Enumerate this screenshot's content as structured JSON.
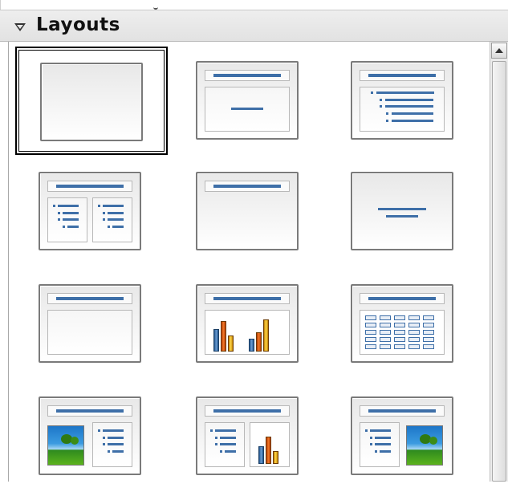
{
  "panel": {
    "title": "Layouts",
    "collapse_icon": "triangle-down-icon"
  },
  "layouts": [
    {
      "id": "blank-slide",
      "icon": "layout-blank-icon"
    },
    {
      "id": "title-slide",
      "icon": "layout-title-subtitle-icon"
    },
    {
      "id": "title-content",
      "icon": "layout-title-content-icon"
    },
    {
      "id": "title-2-content",
      "icon": "layout-title-2-content-icon"
    },
    {
      "id": "title-only",
      "icon": "layout-title-only-icon"
    },
    {
      "id": "centered-text",
      "icon": "layout-centered-text-icon"
    },
    {
      "id": "title-2-content-text",
      "icon": "layout-title-text-icon"
    },
    {
      "id": "title-chart",
      "icon": "layout-title-chart-icon"
    },
    {
      "id": "title-table",
      "icon": "layout-title-table-icon"
    },
    {
      "id": "title-picture-text",
      "icon": "layout-title-picture-text-icon"
    },
    {
      "id": "title-text-chart",
      "icon": "layout-title-text-chart-icon"
    },
    {
      "id": "title-text-picture",
      "icon": "layout-title-text-picture-icon"
    }
  ],
  "selected_index": 0,
  "colors": {
    "accent": "#3e6fa8",
    "header_bg": "#e8e8e8",
    "selection": "#000000"
  }
}
